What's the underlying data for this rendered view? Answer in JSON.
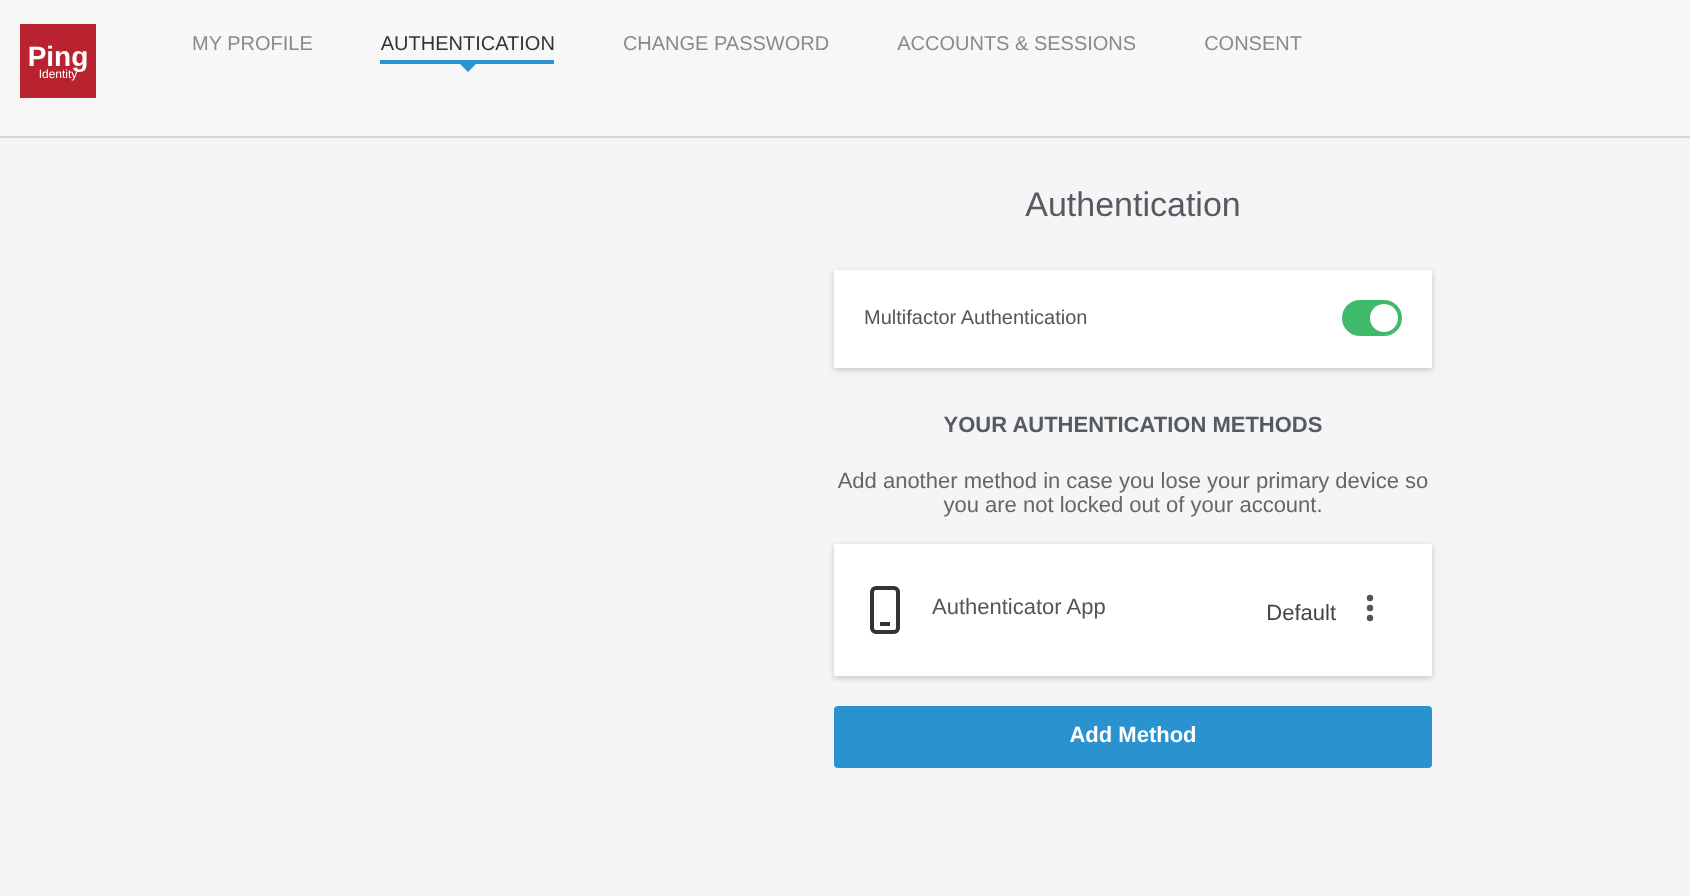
{
  "logo": {
    "name": "Ping",
    "subtext": "Identity"
  },
  "tabs": [
    {
      "label": "MY PROFILE",
      "selected": false
    },
    {
      "label": "AUTHENTICATION",
      "selected": true
    },
    {
      "label": "CHANGE PASSWORD",
      "selected": false
    },
    {
      "label": "ACCOUNTS & SESSIONS",
      "selected": false
    },
    {
      "label": "CONSENT",
      "selected": false
    }
  ],
  "title": "Authentication",
  "mfa": {
    "label": "Multifactor Authentication",
    "on": true
  },
  "methods_heading": "YOUR AUTHENTICATION METHODS",
  "methods_description": "Add another method in case you lose your primary device so you are not locked out of your account.",
  "methods": [
    {
      "name": "Authenticator App",
      "badge": "Default"
    }
  ],
  "add_button": "Add Method"
}
